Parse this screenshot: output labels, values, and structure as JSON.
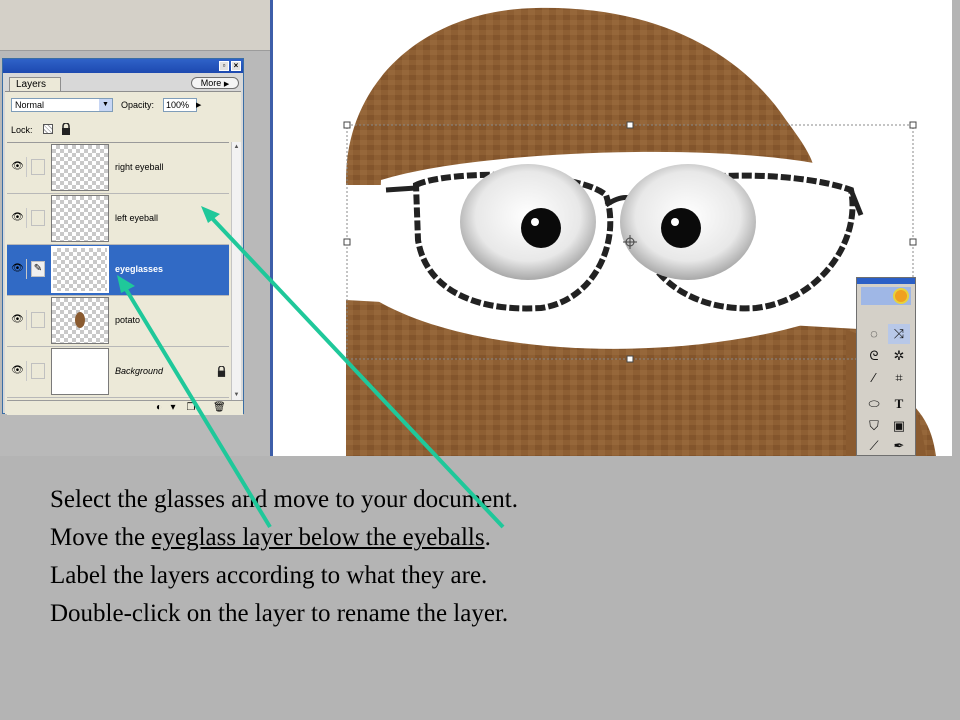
{
  "layers_palette": {
    "tab_label": "Layers",
    "more_label": "More",
    "more_arrow": "▶",
    "blend_mode": "Normal",
    "opacity_label": "Opacity:",
    "opacity_value": "100%",
    "lock_label": "Lock:",
    "layers": [
      {
        "name": "right eyeball",
        "visible": true,
        "selected": false
      },
      {
        "name": "left eyeball",
        "visible": true,
        "selected": false
      },
      {
        "name": "eyeglasses",
        "visible": true,
        "selected": true
      },
      {
        "name": "potato",
        "visible": true,
        "selected": false
      },
      {
        "name": "Background",
        "visible": true,
        "selected": false,
        "locked": true
      }
    ]
  },
  "instructions": {
    "line1": "Select the glasses and move to your document.",
    "line2_prefix": "Move the ",
    "line2_underlined": "eyeglass layer below the eyeballs",
    "line2_suffix": ".",
    "line3": "Label the layers according to what they are.",
    "line4": "Double-click on the layer to rename the layer."
  },
  "toolbox": {
    "tools": [
      "marquee-icon",
      "move-icon",
      "lasso-icon",
      "magic-wand-icon",
      "healing-brush-icon",
      "crop-icon",
      "slice-icon",
      "type-icon",
      "paint-bucket-icon",
      "gradient-icon",
      "brush-icon",
      "pen-icon"
    ]
  },
  "colors": {
    "slide_background": "#b4b4b4",
    "selection_blue": "#316ac5",
    "arrow_color": "#1fc89a",
    "potato_brown": "#8a5a2e"
  }
}
